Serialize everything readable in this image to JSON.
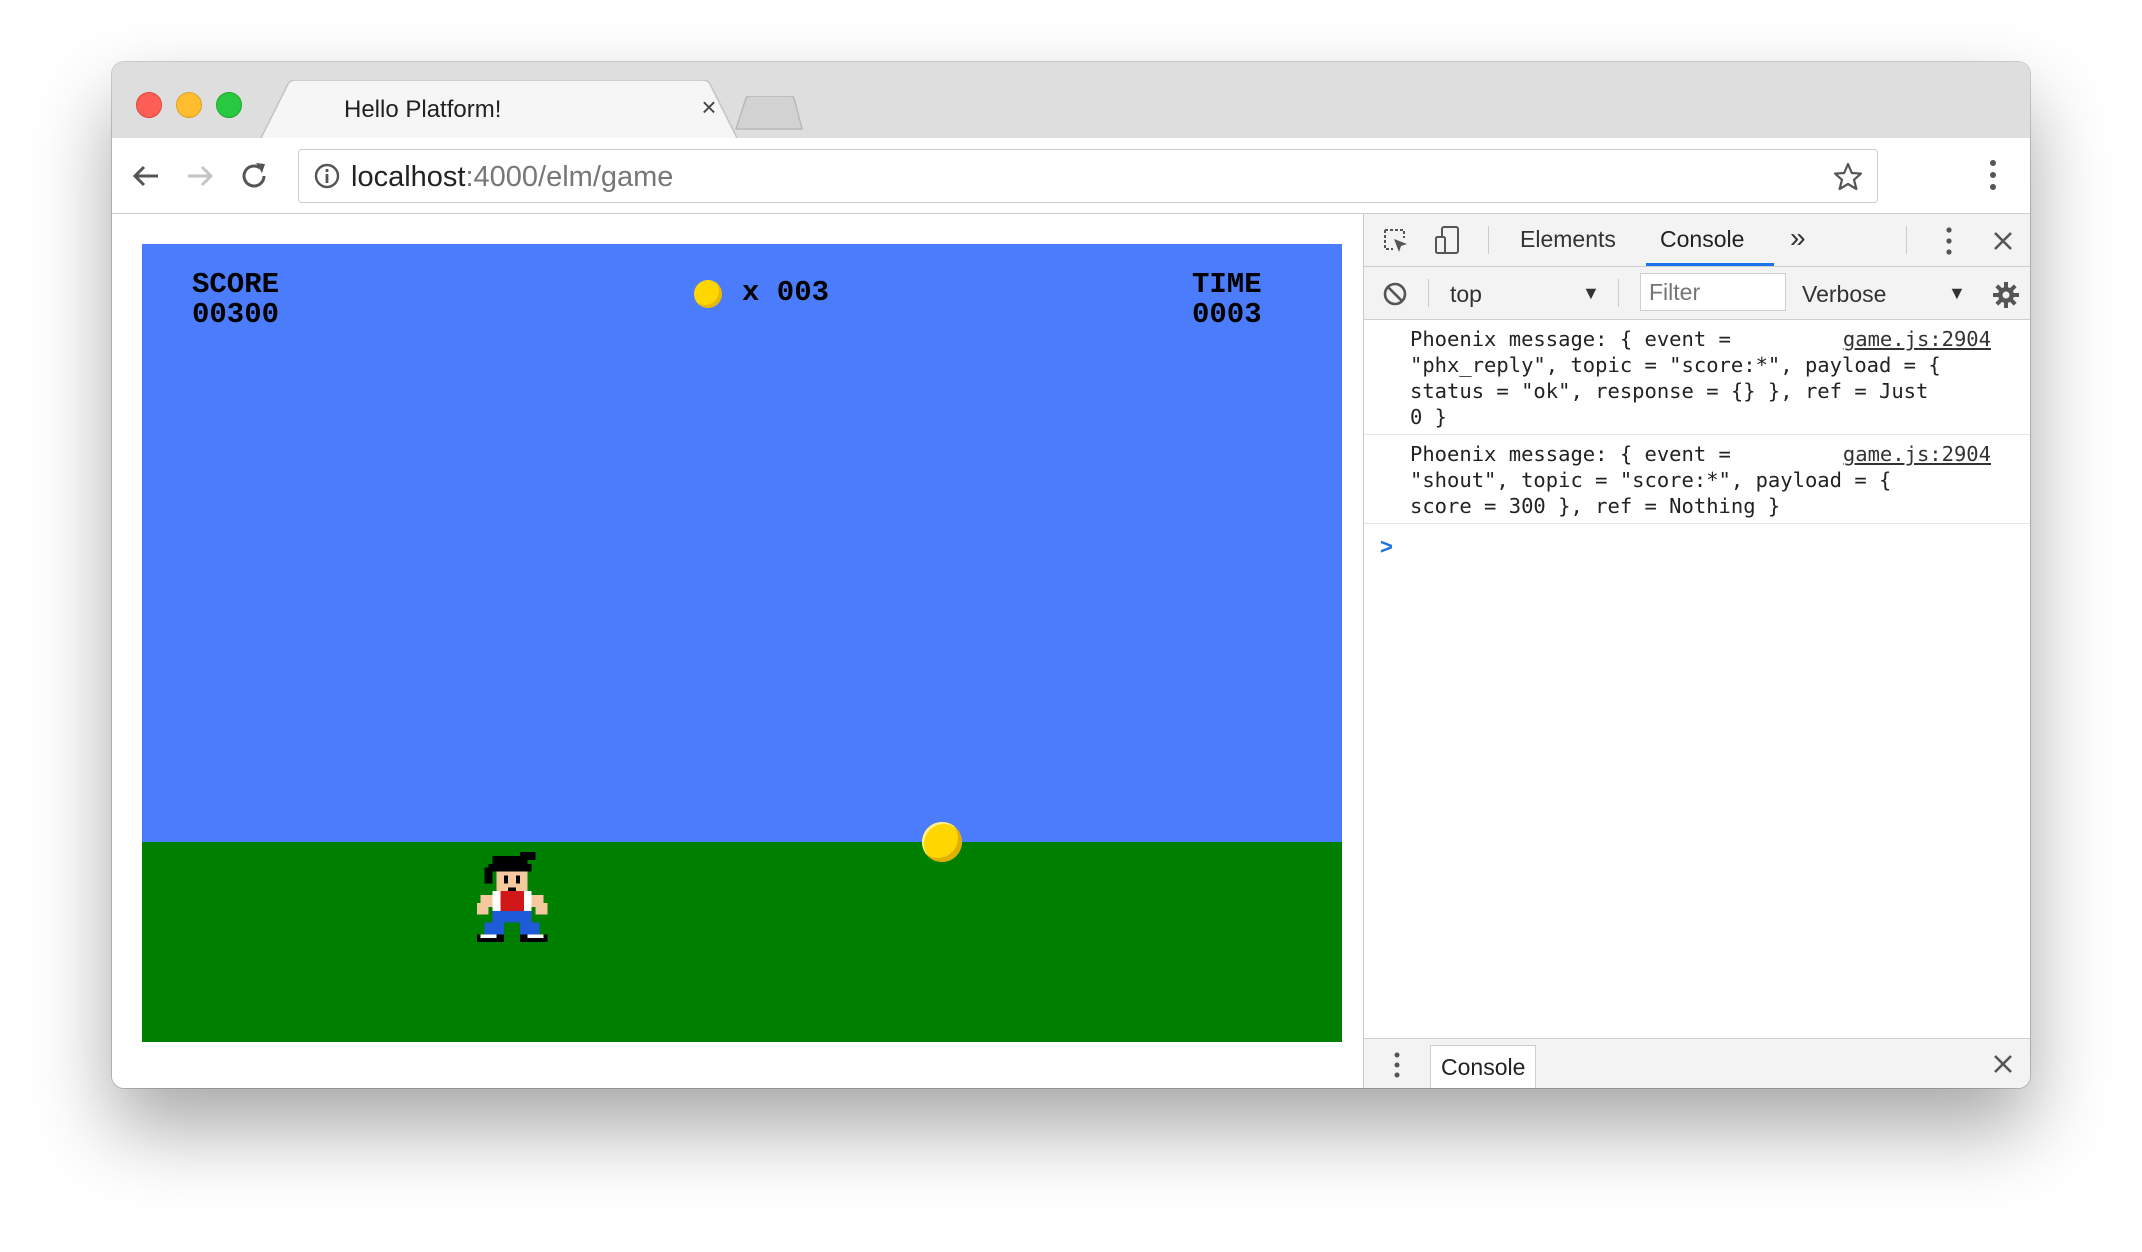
{
  "browser": {
    "tab_title": "Hello Platform!",
    "tab_close": "×",
    "url_host": "localhost",
    "url_path": ":4000/elm/game"
  },
  "game": {
    "score_label": "SCORE",
    "score_value": "00300",
    "coins_text": "x 003",
    "time_label": "TIME",
    "time_value": "0003"
  },
  "devtools": {
    "tabs": [
      "Elements",
      "Console"
    ],
    "more_tabs": "»",
    "context": "top",
    "filter_placeholder": "Filter",
    "level": "Verbose",
    "messages": [
      {
        "text": "Phoenix message: { event =\n\"phx_reply\", topic = \"score:*\", payload = {\nstatus = \"ok\", response = {} }, ref = Just\n0 }",
        "source": "game.js:2904"
      },
      {
        "text": "Phoenix message: { event =\n\"shout\", topic = \"score:*\", payload = {\nscore = 300 }, ref = Nothing }",
        "source": "game.js:2904"
      }
    ],
    "prompt": ">",
    "drawer_tab": "Console",
    "drawer_close": "×"
  },
  "colors": {
    "sky": "#4a7cfb",
    "ground": "#008000",
    "coin": "#ffd700",
    "accent": "#1a73e8"
  }
}
